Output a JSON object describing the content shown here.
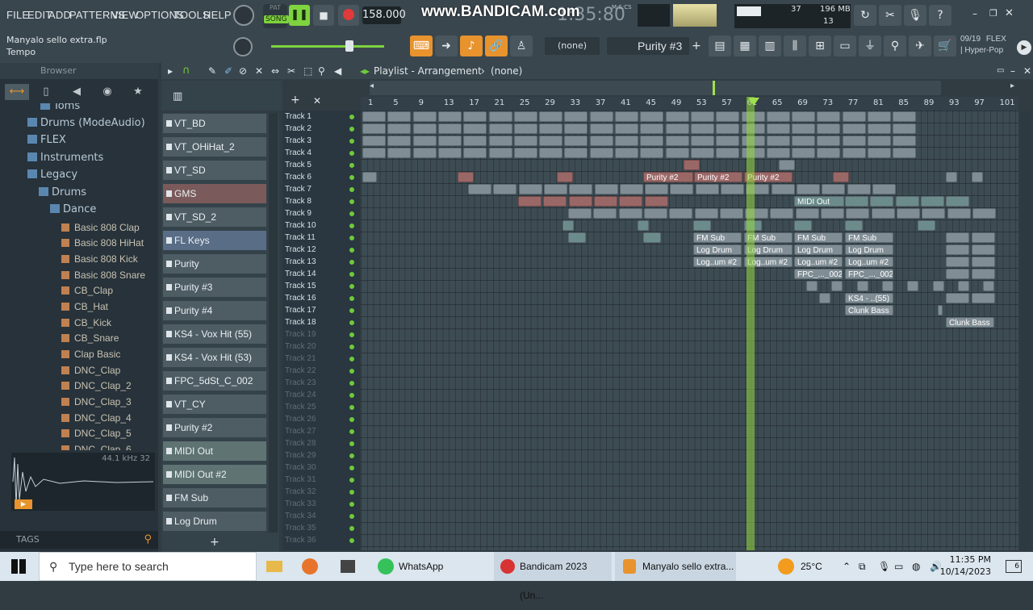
{
  "menu": [
    "FILE",
    "EDIT",
    "ADD",
    "PATTERNS",
    "VIEW",
    "OPTIONS",
    "TOOLS",
    "HELP"
  ],
  "project": {
    "filename": "Manyalo sello extra.flp",
    "hint": "Tempo"
  },
  "transport": {
    "pat_label": "PAT",
    "song_label": "SONG",
    "tempo": "158.000",
    "time": "1:35:80",
    "time_label": "M:S:CS",
    "memory": "196 MB",
    "mem_num": "37",
    "cpu": "13"
  },
  "watermark": "www.BANDICAM.com",
  "pattern_selector": {
    "none": "(none)",
    "pattern": "Purity #3",
    "plus": "+"
  },
  "news": {
    "date": "09/19",
    "tag": "FLEX",
    "title": "| Hyper-Pop"
  },
  "browser": {
    "title": "Browser",
    "folders": [
      {
        "label": "Toms",
        "indent": 2
      },
      {
        "label": "Drums (ModeAudio)",
        "indent": 1
      },
      {
        "label": "FLEX",
        "indent": 1
      },
      {
        "label": "Instruments",
        "indent": 1
      },
      {
        "label": "Legacy",
        "indent": 1
      },
      {
        "label": "Drums",
        "indent": 2
      },
      {
        "label": "Dance",
        "indent": 3
      }
    ],
    "samples": [
      "Basic 808 Clap",
      "Basic 808 HiHat",
      "Basic 808 Kick",
      "Basic 808 Snare",
      "CB_Clap",
      "CB_Hat",
      "CB_Kick",
      "CB_Snare",
      "Clap Basic",
      "DNC_Clap",
      "DNC_Clap_2",
      "DNC_Clap_3",
      "DNC_Clap_4",
      "DNC_Clap_5",
      "DNC_Clap_6"
    ],
    "wave_info": "44.1 kHz 32",
    "tags_label": "TAGS"
  },
  "channels": [
    "VT_BD",
    "VT_OHiHat_2",
    "VT_SD",
    "GMS",
    "VT_SD_2",
    "FL Keys",
    "Purity",
    "Purity #3",
    "Purity #4",
    "KS4 - Vox Hit (55)",
    "KS4 - Vox Hit (53)",
    "FPC_5dSt_C_002",
    "VT_CY",
    "Purity #2",
    "MIDI Out",
    "MIDI Out #2",
    "FM Sub",
    "Log Drum"
  ],
  "playlist": {
    "title": "Playlist - Arrangement",
    "sep": "›",
    "pattern": "(none)"
  },
  "ruler": [
    "1",
    "5",
    "9",
    "13",
    "17",
    "21",
    "25",
    "29",
    "33",
    "37",
    "41",
    "45",
    "49",
    "53",
    "57",
    "61",
    "65",
    "69",
    "73",
    "77",
    "81",
    "85",
    "89",
    "93",
    "97",
    "101"
  ],
  "tracks": [
    "Track 1",
    "Track 2",
    "Track 3",
    "Track 4",
    "Track 5",
    "Track 6",
    "Track 7",
    "Track 8",
    "Track 9",
    "Track 10",
    "Track 11",
    "Track 12",
    "Track 13",
    "Track 14",
    "Track 15",
    "Track 16",
    "Track 17",
    "Track 18",
    "Track 19",
    "Track 20",
    "Track 21",
    "Track 22",
    "Track 23",
    "Track 24",
    "Track 25",
    "Track 26",
    "Track 27",
    "Track 28",
    "Track 29",
    "Track 30",
    "Track 31",
    "Track 32",
    "Track 33",
    "Track 34",
    "Track 35",
    "Track 36"
  ],
  "clip_labels": {
    "purity2": "Purity #2",
    "midi": "MIDI Out",
    "fmsub": "FM Sub",
    "logdrum": "Log Drum",
    "logum": "Log..um #2",
    "fpc": "FPC_..._002",
    "ks4": "KS4 - ..(55)",
    "clunk": "Clunk Bass"
  },
  "taskbar": {
    "search": "Type here to search",
    "whatsapp": "WhatsApp",
    "bandicam": "Bandicam 2023 (Un...",
    "flstudio": "Manyalo sello extra...",
    "weather": "25°C",
    "time": "11:35 PM",
    "date": "10/14/2023",
    "notif": "6"
  }
}
